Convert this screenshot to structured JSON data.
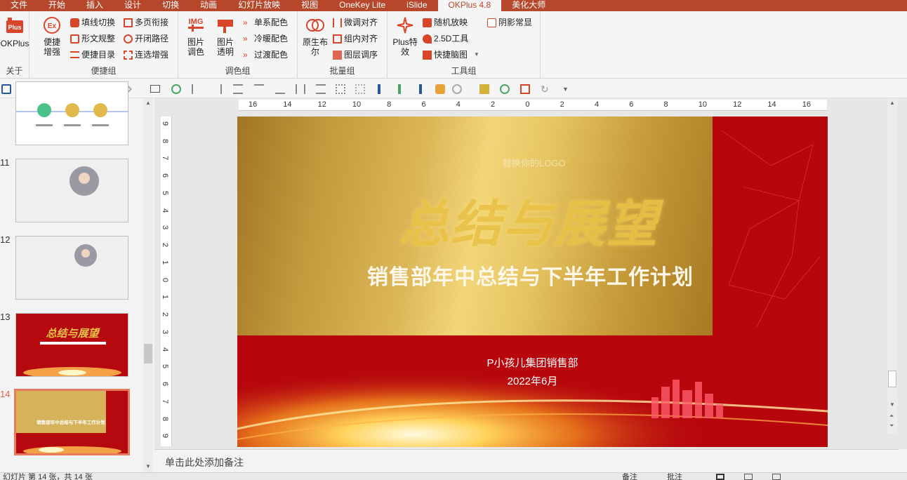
{
  "tabs": [
    "文件",
    "开始",
    "插入",
    "设计",
    "切换",
    "动画",
    "幻灯片放映",
    "视图",
    "OneKey Lite",
    "iSlide",
    "OKPlus 4.8",
    "美化大师"
  ],
  "active_tab": "OKPlus 4.8",
  "groups": {
    "about": {
      "label": "关于",
      "okplus": "OKPlus"
    },
    "quick": {
      "label": "便捷组",
      "big": "便捷\n增强",
      "items": [
        "填线切换",
        "多页衔接",
        "形文规整",
        "开闭路径",
        "便捷目录",
        "连选增强"
      ]
    },
    "color": {
      "label": "调色组",
      "img_tag": "IMG",
      "img_color": "图片\n调色",
      "img_transparent": "图片\n透明",
      "items": [
        "单系配色",
        "冷暖配色",
        "过渡配色"
      ]
    },
    "batch": {
      "label": "批量组",
      "big": "原生布\n尔",
      "items": [
        "微调对齐",
        "组内对齐",
        "图层调序"
      ]
    },
    "tools": {
      "label": "工具组",
      "big": "Plus特\n效",
      "items": [
        "随机放映",
        "2.5D工具",
        "快捷脑图",
        "阴影常显"
      ]
    }
  },
  "ruler": {
    "h_ticks": [
      "16",
      "14",
      "12",
      "10",
      "8",
      "6",
      "4",
      "2",
      "0",
      "2",
      "4",
      "6",
      "8",
      "10",
      "12",
      "14",
      "16"
    ],
    "v_ticks": [
      "9",
      "8",
      "7",
      "6",
      "5",
      "4",
      "3",
      "2",
      "1",
      "0",
      "1",
      "2",
      "3",
      "4",
      "5",
      "6",
      "7",
      "8",
      "9"
    ]
  },
  "thumbnails": [
    {
      "num": "",
      "title": ""
    },
    {
      "num": "11",
      "title": ""
    },
    {
      "num": "12",
      "title": ""
    },
    {
      "num": "13",
      "title": "总结与展望"
    },
    {
      "num": "14",
      "title": "销售部年中总结与下半年工作计划"
    }
  ],
  "slide": {
    "logo": "替换你的LOGO",
    "art_title": "总结与展望",
    "title": "销售部年中总结与下半年工作计划",
    "company": "P小孩儿集团销售部",
    "date": "2022年6月"
  },
  "notes_placeholder": "单击此处添加备注",
  "status": {
    "slide_info": "幻灯片 第 14 张，共 14 张",
    "notes_btn": "备注",
    "comments_btn": "批注"
  },
  "colors": {
    "accent": "#b7472a",
    "slide_red": "#b5080f",
    "gold": "#e9c247"
  }
}
